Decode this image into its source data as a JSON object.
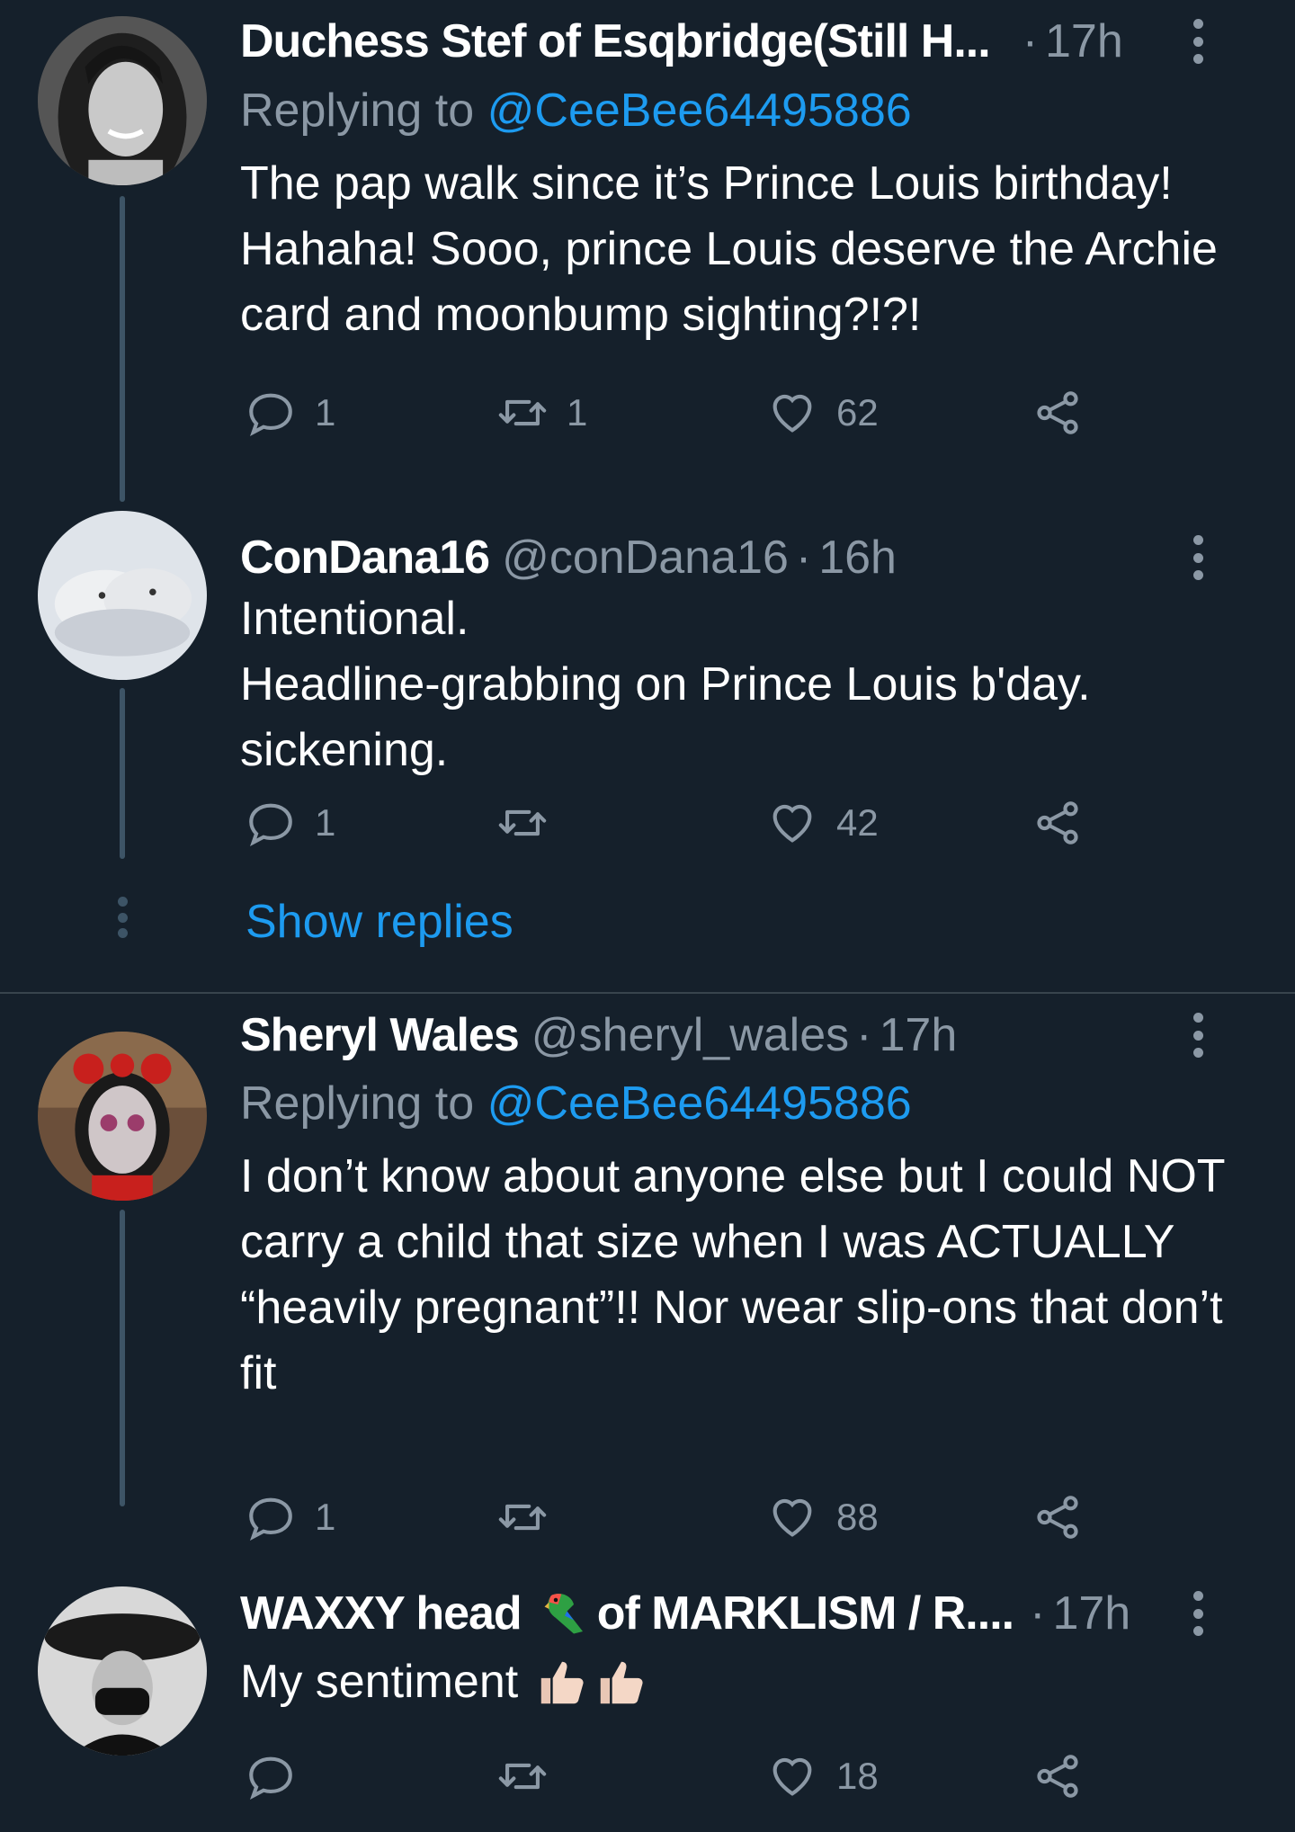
{
  "tweets": [
    {
      "name": "Duchess Stef of Esqbridge(Still H...",
      "handle": "",
      "time": "17h",
      "reply_label": "Replying to",
      "reply_mention": "@CeeBee64495886",
      "text": "The pap walk since it’s Prince Louis birthday! Hahaha! Sooo, prince Louis deserve the Archie card and moonbump sighting?!?!",
      "replies": "1",
      "retweets": "1",
      "likes": "62"
    },
    {
      "name": "ConDana16",
      "handle": "@conDana16",
      "time": "16h",
      "text": "Intentional.\n Headline-grabbing on Prince Louis b'day.\nsickening.",
      "replies": "1",
      "retweets": "",
      "likes": "42"
    },
    {
      "name": "Sheryl Wales",
      "handle": "@sheryl_wales",
      "time": "17h",
      "reply_label": "Replying to",
      "reply_mention": "@CeeBee64495886",
      "text": "I don’t know about anyone else but I could NOT carry a child that size when I was ACTUALLY “heavily pregnant”!! Nor wear slip-ons that don’t fit",
      "replies": "1",
      "retweets": "",
      "likes": "88"
    },
    {
      "name_part1": "WAXXY head",
      "name_part2": "of MARKLISM / R....",
      "time": "17h",
      "text": "My sentiment",
      "replies": "",
      "retweets": "",
      "likes": "18"
    }
  ],
  "thread": {
    "show_replies": "Show replies"
  },
  "separator": "·",
  "colors": {
    "background": "#15202b",
    "text": "#ffffff",
    "muted": "#8b98a5",
    "accent": "#1d9bf0",
    "thread_line": "#3d5466",
    "divider": "#38444d"
  },
  "icons": [
    "reply-icon",
    "retweet-icon",
    "like-icon",
    "share-icon",
    "more-icon",
    "parrot-emoji",
    "thumbs-up-emoji"
  ]
}
